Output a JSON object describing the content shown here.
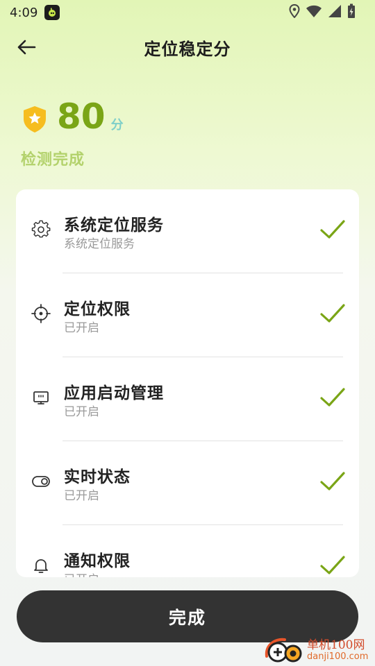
{
  "status_bar": {
    "time": "4:09",
    "icons": [
      "app-notification-icon",
      "location-icon",
      "wifi-icon",
      "signal-icon",
      "battery-charging-icon"
    ]
  },
  "header": {
    "back_icon": "arrow-left-icon",
    "title": "定位稳定分"
  },
  "score": {
    "icon": "shield-star-icon",
    "value": "80",
    "unit": "分",
    "status": "检测完成"
  },
  "colors": {
    "accent_green": "#7aa516",
    "status_green": "#b3d26c",
    "unit_teal": "#7ecfc9",
    "check_green": "#7aa516",
    "button_bg": "#333333"
  },
  "items": [
    {
      "icon": "gear-icon",
      "title": "系统定位服务",
      "subtitle": "系统定位服务",
      "status_icon": "check-icon"
    },
    {
      "icon": "crosshair-icon",
      "title": "定位权限",
      "subtitle": "已开启",
      "status_icon": "check-icon"
    },
    {
      "icon": "monitor-icon",
      "title": "应用启动管理",
      "subtitle": "已开启",
      "status_icon": "check-icon"
    },
    {
      "icon": "toggle-icon",
      "title": "实时状态",
      "subtitle": "已开启",
      "status_icon": "check-icon"
    },
    {
      "icon": "bell-icon",
      "title": "通知权限",
      "subtitle": "已开启",
      "status_icon": "check-icon"
    }
  ],
  "footer": {
    "done_label": "完成"
  },
  "watermark": {
    "text_cn": "单机100网",
    "text_en": "danji100.com"
  }
}
